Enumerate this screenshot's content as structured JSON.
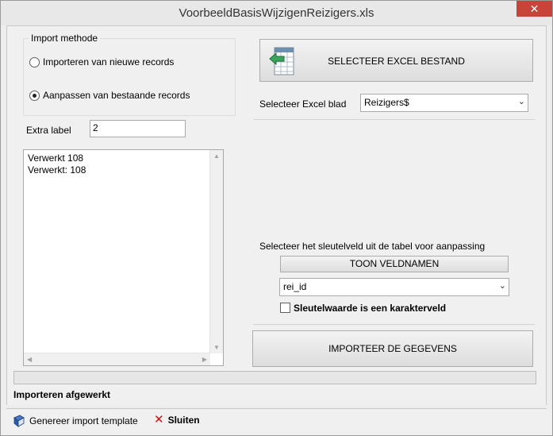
{
  "window": {
    "title": "VoorbeeldBasisWijzigenReizigers.xls",
    "close_glyph": "✕"
  },
  "import_method": {
    "legend": "Import methode",
    "options": [
      {
        "label": "Importeren van nieuwe records",
        "checked": false
      },
      {
        "label": "Aanpassen van bestaande records",
        "checked": true
      }
    ]
  },
  "extra_label": {
    "label": "Extra label",
    "value": "2"
  },
  "log": {
    "lines": [
      "Verwerkt 108",
      "Verwerkt: 108"
    ]
  },
  "excel": {
    "select_button": "SELECTEER EXCEL BESTAND",
    "sheet_label": "Selecteer Excel blad",
    "sheet_value": "Reizigers$"
  },
  "key_field": {
    "instruction": "Selecteer het sleutelveld uit de tabel voor aanpassing",
    "show_fields_button": "TOON VELDNAMEN",
    "field_value": "rei_id",
    "char_field_label": "Sleutelwaarde is een karakterveld",
    "char_field_checked": false
  },
  "import_button": "IMPORTEER DE GEGEVENS",
  "progress": {
    "value": 0
  },
  "status": "Importeren afgewerkt",
  "toolbar": {
    "template_label": "Genereer import template",
    "close_label": "Sluiten"
  },
  "icons": {
    "excel": "excel-file-icon",
    "template": "book-icon",
    "close": "red-x-icon",
    "dropdown": "chevron-down-icon"
  },
  "colors": {
    "close_button": "#c7443a",
    "close_x": "#cc1111"
  }
}
